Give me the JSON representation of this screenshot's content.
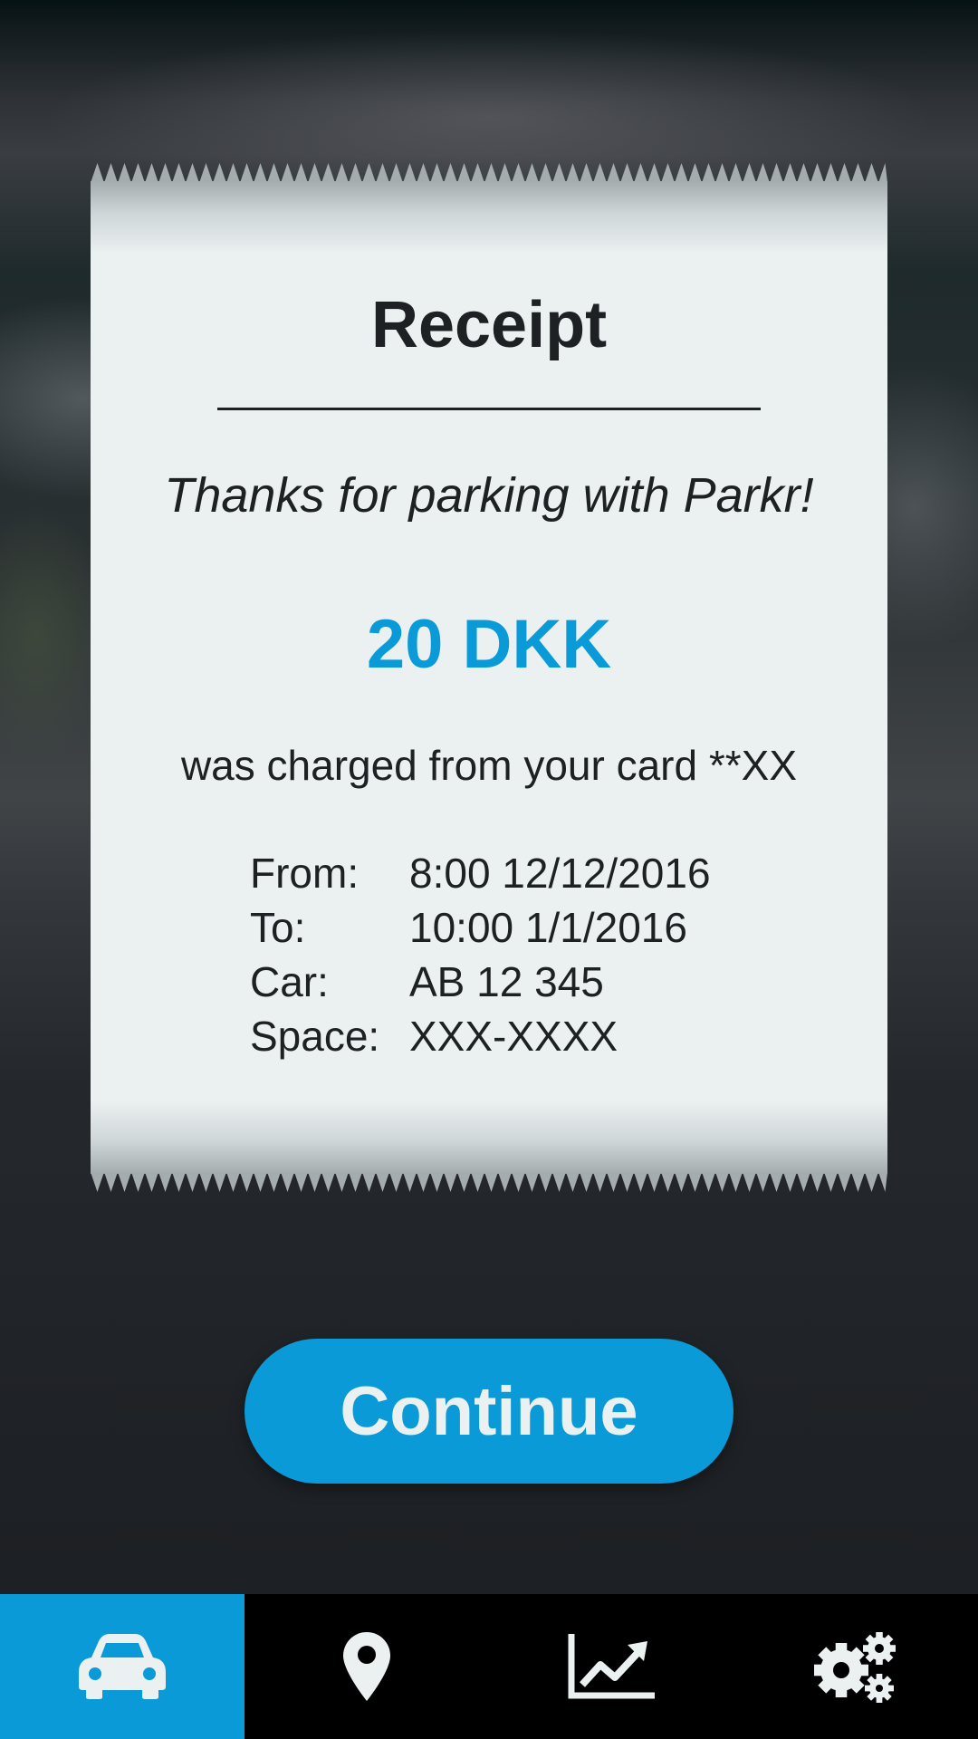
{
  "receipt": {
    "title": "Receipt",
    "thanks": "Thanks for parking with Parkr!",
    "amount": "20 DKK",
    "charged_text": "was charged from your card **XX",
    "details": [
      {
        "label": "From:",
        "value": "8:00 12/12/2016"
      },
      {
        "label": "To:",
        "value": "10:00 1/1/2016"
      },
      {
        "label": "Car:",
        "value": "AB 12 345"
      },
      {
        "label": "Space:",
        "value": "XXX-XXXX"
      }
    ]
  },
  "actions": {
    "continue_label": "Continue"
  },
  "nav": {
    "items": [
      {
        "icon": "car-icon",
        "active": true
      },
      {
        "icon": "map-pin-icon",
        "active": false
      },
      {
        "icon": "trend-chart-icon",
        "active": false
      },
      {
        "icon": "gears-icon",
        "active": false
      }
    ]
  },
  "colors": {
    "accent": "#0a9ad8",
    "paper": "#ebf0f1",
    "text": "#1d2124",
    "nav_bg": "#000000"
  }
}
